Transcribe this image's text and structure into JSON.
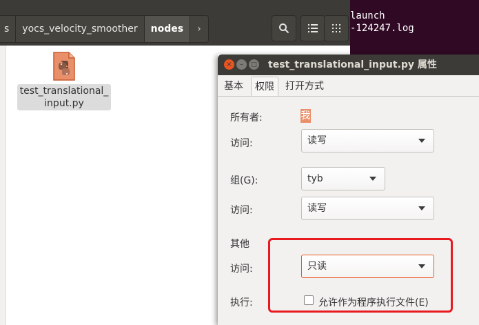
{
  "terminal": {
    "lines": [
      "launch",
      "-124247.log"
    ]
  },
  "file_manager": {
    "breadcrumbs": [
      "s",
      "yocs_velocity_smoother",
      "nodes"
    ],
    "breadcrumb_next_glyph": "›",
    "search_icon": "search-icon",
    "list_view_icon": "list-view-icon",
    "grid_view_icon": "grid-view-icon",
    "file": {
      "name": "test_translational_\ninput.py",
      "icon": "python-file-icon"
    }
  },
  "dialog": {
    "title": "test_translational_input.py 属性",
    "window_buttons": {
      "close": "×",
      "minimize": "–",
      "maximize": "□"
    },
    "tabs": [
      "基本",
      "权限",
      "打开方式"
    ],
    "active_tab": "权限",
    "owner": {
      "label": "所有者:",
      "value": "我"
    },
    "owner_access": {
      "label": "访问:",
      "value": "读写"
    },
    "group": {
      "label": "组(G):",
      "value": "tyb"
    },
    "group_access": {
      "label": "访问:",
      "value": "读写"
    },
    "others": {
      "heading": "其他",
      "access_label": "访问:",
      "access_value": "只读"
    },
    "execute": {
      "label": "执行:",
      "checkbox_label": "允许作为程序执行文件(E)",
      "checked": false
    },
    "highlight_color": "#e8191f",
    "accent_color": "#e95420"
  }
}
